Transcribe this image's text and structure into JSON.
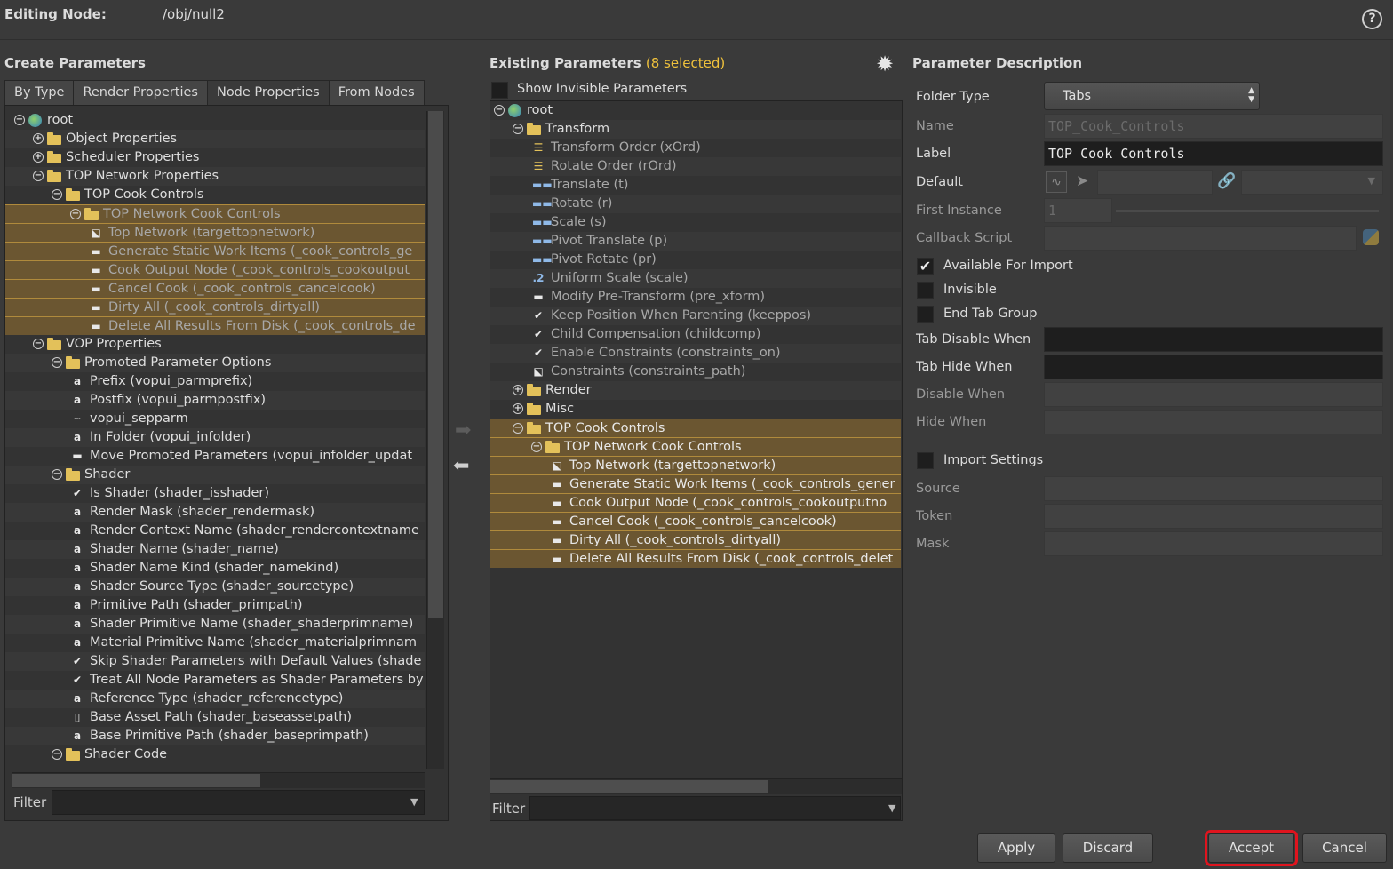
{
  "header": {
    "label": "Editing Node:",
    "path": "/obj/null2",
    "help_icon": "question-icon"
  },
  "create": {
    "title": "Create Parameters",
    "tabs": [
      "By Type",
      "Render Properties",
      "Node Properties",
      "From Nodes"
    ],
    "active_tab": "Node Properties",
    "tree": [
      {
        "label": "root",
        "kind": "globe",
        "depth": 0,
        "pm": "-"
      },
      {
        "label": "Object Properties",
        "kind": "folder",
        "depth": 1,
        "pm": "+"
      },
      {
        "label": "Scheduler Properties",
        "kind": "folder",
        "depth": 1,
        "pm": "+"
      },
      {
        "label": "TOP Network Properties",
        "kind": "folder",
        "depth": 1,
        "pm": "-"
      },
      {
        "label": "TOP Cook Controls",
        "kind": "folder",
        "depth": 2,
        "pm": "-"
      },
      {
        "label": "TOP Network Cook Controls",
        "kind": "folder",
        "depth": 3,
        "pm": "-",
        "hl": true
      },
      {
        "label": "Top Network (targettopnetwork)",
        "kind": "op",
        "depth": 4,
        "hl": true
      },
      {
        "label": "Generate Static Work Items (_cook_controls_ge",
        "kind": "btn",
        "depth": 4,
        "hl": true
      },
      {
        "label": "Cook Output Node (_cook_controls_cookoutput",
        "kind": "btn",
        "depth": 4,
        "hl": true
      },
      {
        "label": "Cancel Cook (_cook_controls_cancelcook)",
        "kind": "btn",
        "depth": 4,
        "hl": true
      },
      {
        "label": "Dirty All (_cook_controls_dirtyall)",
        "kind": "btn",
        "depth": 4,
        "hl": true
      },
      {
        "label": "Delete All Results From Disk (_cook_controls_de",
        "kind": "btn",
        "depth": 4,
        "hl": true
      },
      {
        "label": "VOP Properties",
        "kind": "folder",
        "depth": 1,
        "pm": "-"
      },
      {
        "label": "Promoted Parameter Options",
        "kind": "folder",
        "depth": 2,
        "pm": "-"
      },
      {
        "label": "Prefix (vopui_parmprefix)",
        "kind": "str",
        "depth": 3
      },
      {
        "label": "Postfix (vopui_parmpostfix)",
        "kind": "str",
        "depth": 3
      },
      {
        "label": "vopui_sepparm",
        "kind": "sep",
        "depth": 3
      },
      {
        "label": "In Folder (vopui_infolder)",
        "kind": "str",
        "depth": 3
      },
      {
        "label": "Move Promoted Parameters (vopui_infolder_updat",
        "kind": "btn",
        "depth": 3
      },
      {
        "label": "Shader",
        "kind": "folder",
        "depth": 2,
        "pm": "-"
      },
      {
        "label": "Is Shader (shader_isshader)",
        "kind": "check",
        "depth": 3
      },
      {
        "label": "Render Mask (shader_rendermask)",
        "kind": "str",
        "depth": 3
      },
      {
        "label": "Render Context Name (shader_rendercontextname",
        "kind": "str",
        "depth": 3
      },
      {
        "label": "Shader Name (shader_name)",
        "kind": "str",
        "depth": 3
      },
      {
        "label": "Shader Name Kind (shader_namekind)",
        "kind": "str",
        "depth": 3
      },
      {
        "label": "Shader Source Type (shader_sourcetype)",
        "kind": "str",
        "depth": 3
      },
      {
        "label": "Primitive Path (shader_primpath)",
        "kind": "str",
        "depth": 3
      },
      {
        "label": "Shader Primitive Name (shader_shaderprimname)",
        "kind": "str",
        "depth": 3
      },
      {
        "label": "Material Primitive Name (shader_materialprimnam",
        "kind": "str",
        "depth": 3
      },
      {
        "label": "Skip Shader Parameters with Default Values (shade",
        "kind": "check",
        "depth": 3
      },
      {
        "label": "Treat All Node Parameters as Shader Parameters by",
        "kind": "check",
        "depth": 3
      },
      {
        "label": "Reference Type (shader_referencetype)",
        "kind": "str",
        "depth": 3
      },
      {
        "label": "Base Asset Path (shader_baseassetpath)",
        "kind": "file",
        "depth": 3
      },
      {
        "label": "Base Primitive Path (shader_baseprimpath)",
        "kind": "str",
        "depth": 3
      },
      {
        "label": "Shader Code",
        "kind": "folder",
        "depth": 2,
        "pm": "-"
      }
    ],
    "filter_label": "Filter"
  },
  "existing": {
    "title": "Existing Parameters",
    "selected_count": "(8 selected)",
    "show_invisible": "Show Invisible Parameters",
    "tree": [
      {
        "label": "root",
        "kind": "globe",
        "depth": 0,
        "pm": "-"
      },
      {
        "label": "Transform",
        "kind": "folder",
        "depth": 1,
        "pm": "-"
      },
      {
        "label": "Transform Order (xOrd)",
        "kind": "menu",
        "depth": 2,
        "dim": true
      },
      {
        "label": "Rotate Order (rOrd)",
        "kind": "menu",
        "depth": 2,
        "dim": true
      },
      {
        "label": "Translate (t)",
        "kind": "vec",
        "depth": 2,
        "dim": true
      },
      {
        "label": "Rotate (r)",
        "kind": "vec",
        "depth": 2,
        "dim": true
      },
      {
        "label": "Scale (s)",
        "kind": "vec",
        "depth": 2,
        "dim": true
      },
      {
        "label": "Pivot Translate (p)",
        "kind": "vec",
        "depth": 2,
        "dim": true
      },
      {
        "label": "Pivot Rotate (pr)",
        "kind": "vec",
        "depth": 2,
        "dim": true
      },
      {
        "label": "Uniform Scale (scale)",
        "kind": "float",
        "depth": 2,
        "dim": true
      },
      {
        "label": "Modify Pre-Transform (pre_xform)",
        "kind": "btn",
        "depth": 2,
        "dim": true
      },
      {
        "label": "Keep Position When Parenting (keeppos)",
        "kind": "check",
        "depth": 2,
        "dim": true
      },
      {
        "label": "Child Compensation (childcomp)",
        "kind": "check",
        "depth": 2,
        "dim": true
      },
      {
        "label": "Enable Constraints (constraints_on)",
        "kind": "check",
        "depth": 2,
        "dim": true
      },
      {
        "label": "Constraints (constraints_path)",
        "kind": "op",
        "depth": 2,
        "dim": true
      },
      {
        "label": "Render",
        "kind": "folder",
        "depth": 1,
        "pm": "+"
      },
      {
        "label": "Misc",
        "kind": "folder",
        "depth": 1,
        "pm": "+"
      },
      {
        "label": "TOP Cook Controls",
        "kind": "folder",
        "depth": 1,
        "pm": "-",
        "hl": true
      },
      {
        "label": "TOP Network Cook Controls",
        "kind": "folder",
        "depth": 2,
        "pm": "-",
        "hl": true
      },
      {
        "label": "Top Network (targettopnetwork)",
        "kind": "op",
        "depth": 3,
        "hl": true
      },
      {
        "label": "Generate Static Work Items (_cook_controls_gener",
        "kind": "btn",
        "depth": 3,
        "hl": true
      },
      {
        "label": "Cook Output Node (_cook_controls_cookoutputno",
        "kind": "btn",
        "depth": 3,
        "hl": true
      },
      {
        "label": "Cancel Cook (_cook_controls_cancelcook)",
        "kind": "btn",
        "depth": 3,
        "hl": true
      },
      {
        "label": "Dirty All (_cook_controls_dirtyall)",
        "kind": "btn",
        "depth": 3,
        "hl": true
      },
      {
        "label": "Delete All Results From Disk (_cook_controls_delet",
        "kind": "btn",
        "depth": 3,
        "hl": true
      }
    ],
    "filter_label": "Filter",
    "gear_icon": "gear-icon"
  },
  "description": {
    "title": "Parameter Description",
    "folder_type_label": "Folder Type",
    "folder_type_value": "Tabs",
    "name_label": "Name",
    "name_value": "TOP_Cook_Controls",
    "label_label": "Label",
    "label_value": "TOP Cook Controls",
    "default_label": "Default",
    "first_instance_label": "First Instance",
    "first_instance_value": "1",
    "callback_label": "Callback Script",
    "available_for_import": "Available For Import",
    "invisible": "Invisible",
    "end_tab_group": "End Tab Group",
    "tab_disable_when": "Tab Disable When",
    "tab_hide_when": "Tab Hide When",
    "disable_when": "Disable When",
    "hide_when": "Hide When",
    "import_settings": "Import Settings",
    "source": "Source",
    "token": "Token",
    "mask": "Mask"
  },
  "buttons": {
    "apply": "Apply",
    "discard": "Discard",
    "accept": "Accept",
    "cancel": "Cancel"
  },
  "colors": {
    "highlight": "#6b5631",
    "selected_text": "#f0c23c",
    "accent_ring": "#e0141e"
  }
}
